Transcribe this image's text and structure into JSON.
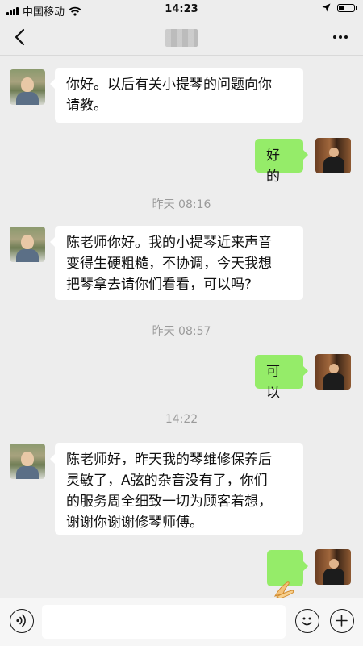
{
  "status_bar": {
    "carrier": "中国移动",
    "time": "14:23"
  },
  "nav": {
    "back_icon": "chevron-left-icon",
    "more_icon": "ellipsis-icon"
  },
  "messages": [
    {
      "side": "other",
      "text": "你好。以后有关小提琴的问题向你\n请教。"
    },
    {
      "side": "me",
      "text": "好的"
    },
    {
      "side": "time",
      "text": "昨天 08:16"
    },
    {
      "side": "other",
      "text": "陈老师你好。我的小提琴近来声音\n变得生硬粗糙，不协调，今天我想\n把琴拿去请你们看看，可以吗?"
    },
    {
      "side": "time",
      "text": "昨天 08:57"
    },
    {
      "side": "me",
      "text": "可以"
    },
    {
      "side": "time",
      "text": "14:22"
    },
    {
      "side": "other",
      "text": "陈老师好，昨天我的琴维修保养后\n灵敏了，A弦的杂音没有了，你们\n的服务周全细致一切为顾客着想，\n谢谢你谢谢修琴师傅。"
    },
    {
      "side": "me",
      "emoji": "praying-hands-icon"
    }
  ],
  "input_bar": {
    "voice_icon": "voice-icon",
    "emoji_icon": "smiley-icon",
    "plus_icon": "plus-circle-icon"
  }
}
